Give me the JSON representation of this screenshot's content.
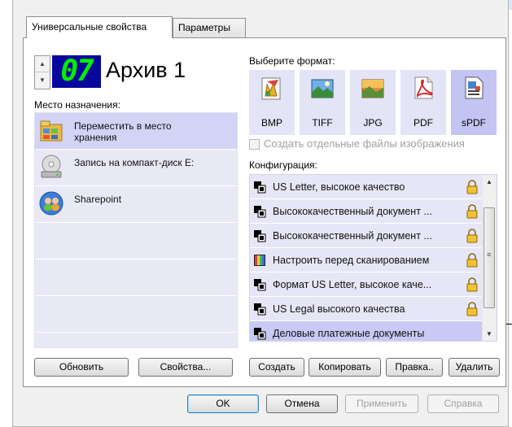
{
  "tabs": [
    {
      "label": "Универсальные свойства"
    },
    {
      "label": "Параметры"
    }
  ],
  "profile": {
    "number": "07",
    "name": "Архив 1"
  },
  "destination": {
    "label": "Место назначения:",
    "items": [
      {
        "label": "Переместить в место хранения",
        "icon": "folder-storage-icon",
        "selected": true
      },
      {
        "label": "Запись на компакт-диск  E:",
        "icon": "cd-drive-icon"
      },
      {
        "label": "Sharepoint",
        "icon": "sharepoint-icon"
      }
    ]
  },
  "left_buttons": {
    "refresh": "Обновить",
    "properties": "Свойства..."
  },
  "format": {
    "label": "Выберите формат:",
    "items": [
      {
        "label": "BMP",
        "icon": "bmp-icon"
      },
      {
        "label": "TIFF",
        "icon": "tiff-icon"
      },
      {
        "label": "JPG",
        "icon": "jpg-icon"
      },
      {
        "label": "PDF",
        "icon": "pdf-icon"
      },
      {
        "label": "sPDF",
        "icon": "spdf-icon",
        "selected": true
      }
    ],
    "separate_files": "Создать отдельные файлы изображения"
  },
  "config": {
    "label": "Конфигурация:",
    "items": [
      {
        "label": "US Letter, высокое качество"
      },
      {
        "label": "Высококачественный документ ..."
      },
      {
        "label": "Высококачественный документ ..."
      },
      {
        "label": "Настроить перед сканированием",
        "icon": "color-bars-icon"
      },
      {
        "label": "Формат US Letter, высокое каче..."
      },
      {
        "label": "US Legal высокого качества"
      },
      {
        "label": "Деловые платежные документы",
        "selected": true
      }
    ]
  },
  "config_buttons": {
    "create": "Создать",
    "copy": "Копировать",
    "edit": "Правка..",
    "delete": "Удалить"
  },
  "dialog_buttons": {
    "ok": "OK",
    "cancel": "Отмена",
    "apply": "Применить",
    "help": "Справка"
  },
  "colors": {
    "accent": "#06079c",
    "lcd_digits": "#00f000",
    "selection": "#c9c9f5"
  }
}
